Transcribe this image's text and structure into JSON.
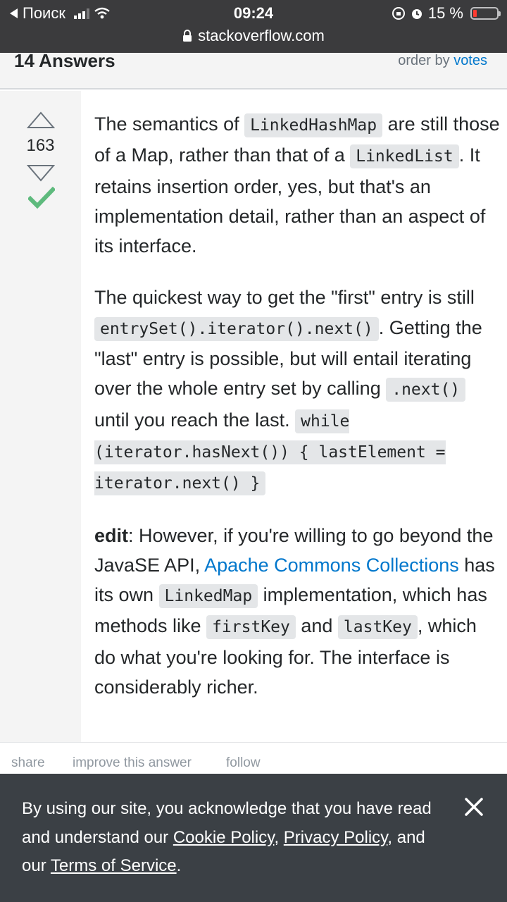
{
  "status_bar": {
    "back_label": "Поиск",
    "time": "09:24",
    "battery_percent": "15 %",
    "battery_level": 0.15,
    "icons": [
      "back-arrow-icon",
      "signal-icon",
      "wifi-icon",
      "rotation-lock-icon",
      "alarm-icon",
      "battery-icon"
    ]
  },
  "browser": {
    "url": "stackoverflow.com"
  },
  "answers_header": {
    "count_label": "14 Answers",
    "order_by_label": "order by",
    "order_by_value": "votes"
  },
  "answer": {
    "score": "163",
    "accepted": true,
    "p1": {
      "t1": "The semantics of ",
      "c1": "LinkedHashMap",
      "t2": " are still those of a Map, rather than that of a ",
      "c2": "LinkedList",
      "t3": ". It retains insertion order, yes, but that's an implementation detail, rather than an aspect of its interface."
    },
    "p2": {
      "t1": "The quickest way to get the \"first\" entry is still ",
      "c1": "entrySet().iterator().next()",
      "t2": ". Getting the \"last\" entry is possible, but will entail iterating over the whole entry set by calling ",
      "c2": ".next()",
      "t3": " until you reach the last. ",
      "c3": "while (iterator.hasNext()) { lastElement = iterator.next() }"
    },
    "p3": {
      "bold": "edit",
      "t1": ": However, if you're willing to go beyond the JavaSE API, ",
      "link": "Apache Commons Collections",
      "t2": " has its own ",
      "c1": "LinkedMap",
      "t3": " implementation, which has methods like ",
      "c2": "firstKey",
      "t4": " and ",
      "c3": "lastKey",
      "t5": ", which do what you're looking for. The interface is considerably richer."
    }
  },
  "post_actions": {
    "share": "share",
    "improve": "improve this answer",
    "follow": "follow"
  },
  "cookie_banner": {
    "t1": "By using our site, you acknowledge that you have read and understand our ",
    "cookie_policy": "Cookie Policy",
    "sep": ", ",
    "privacy_policy": "Privacy Policy",
    "t2": ", and our ",
    "terms": "Terms of Service",
    "t3": "."
  },
  "colors": {
    "link": "#0077cc",
    "accepted": "#5eba7d",
    "banner_bg": "#3b4045",
    "status_bg": "#3b3b3d"
  }
}
